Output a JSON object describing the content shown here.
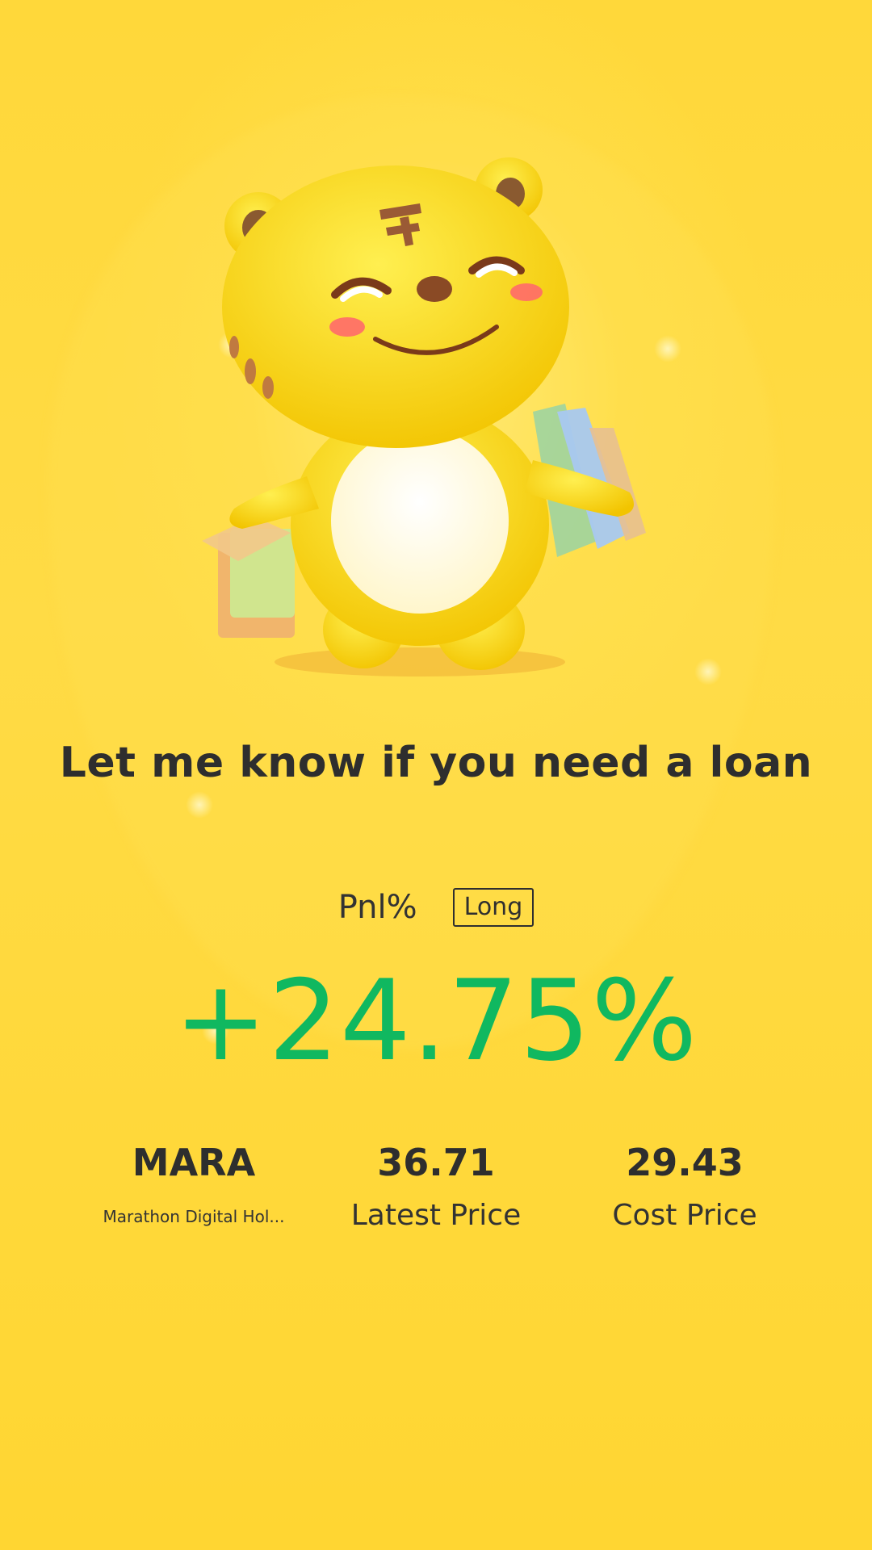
{
  "headline": "Let me know if you need a loan",
  "pnl": {
    "label": "Pnl%",
    "side_badge": "Long",
    "value": "+24.75%"
  },
  "stock": {
    "symbol": "MARA",
    "name": "Marathon Digital Hol...",
    "latest_price": "36.71",
    "latest_price_label": "Latest Price",
    "cost_price": "29.43",
    "cost_price_label": "Cost Price"
  },
  "colors": {
    "background": "#ffd634",
    "gain": "#10b860",
    "text": "#2f2f2f"
  },
  "icons": {
    "mascot": "tiger-mascot-shopping-icon"
  }
}
